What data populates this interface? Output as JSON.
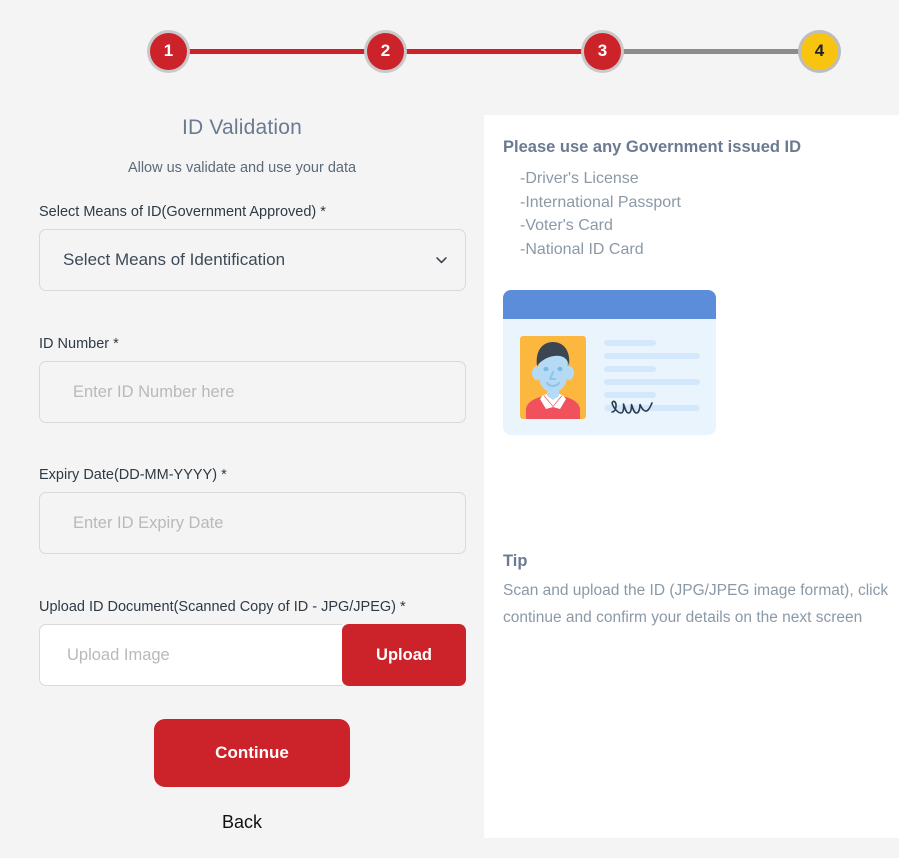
{
  "stepper": {
    "steps": [
      {
        "label": "1",
        "state": "done"
      },
      {
        "label": "2",
        "state": "done"
      },
      {
        "label": "3",
        "state": "done"
      },
      {
        "label": "4",
        "state": "active"
      }
    ],
    "colors": {
      "done": "#cc2229",
      "active": "#f9c410",
      "bar_todo": "#8c8c8c"
    }
  },
  "form": {
    "title": "ID Validation",
    "subtitle": "Allow us validate and use your data",
    "means_label": "Select Means of ID(Government Approved) *",
    "means_value": "Select Means of Identification",
    "idnumber_label": "ID Number *",
    "idnumber_placeholder": "Enter ID Number here",
    "expiry_label": "Expiry Date(DD-MM-YYYY) *",
    "expiry_placeholder": "Enter ID Expiry Date",
    "upload_label": "Upload ID Document(Scanned Copy of ID - JPG/JPEG) *",
    "upload_placeholder": "Upload Image",
    "upload_button": "Upload",
    "continue_button": "Continue",
    "back_link": "Back"
  },
  "panel": {
    "heading": "Please use any Government issued ID",
    "items": [
      "-Driver's License",
      "-International Passport",
      "-Voter's Card",
      "-National ID Card"
    ],
    "tip_title": "Tip",
    "tip_body": "Scan and upload the ID (JPG/JPEG image format), click continue and confirm your details on the next screen"
  },
  "theme": {
    "brand_red": "#cc2229",
    "accent_yellow": "#f9c410",
    "page_bg": "#f4f4f4",
    "panel_bg": "#ffffff",
    "muted_text": "#8b99a7"
  }
}
